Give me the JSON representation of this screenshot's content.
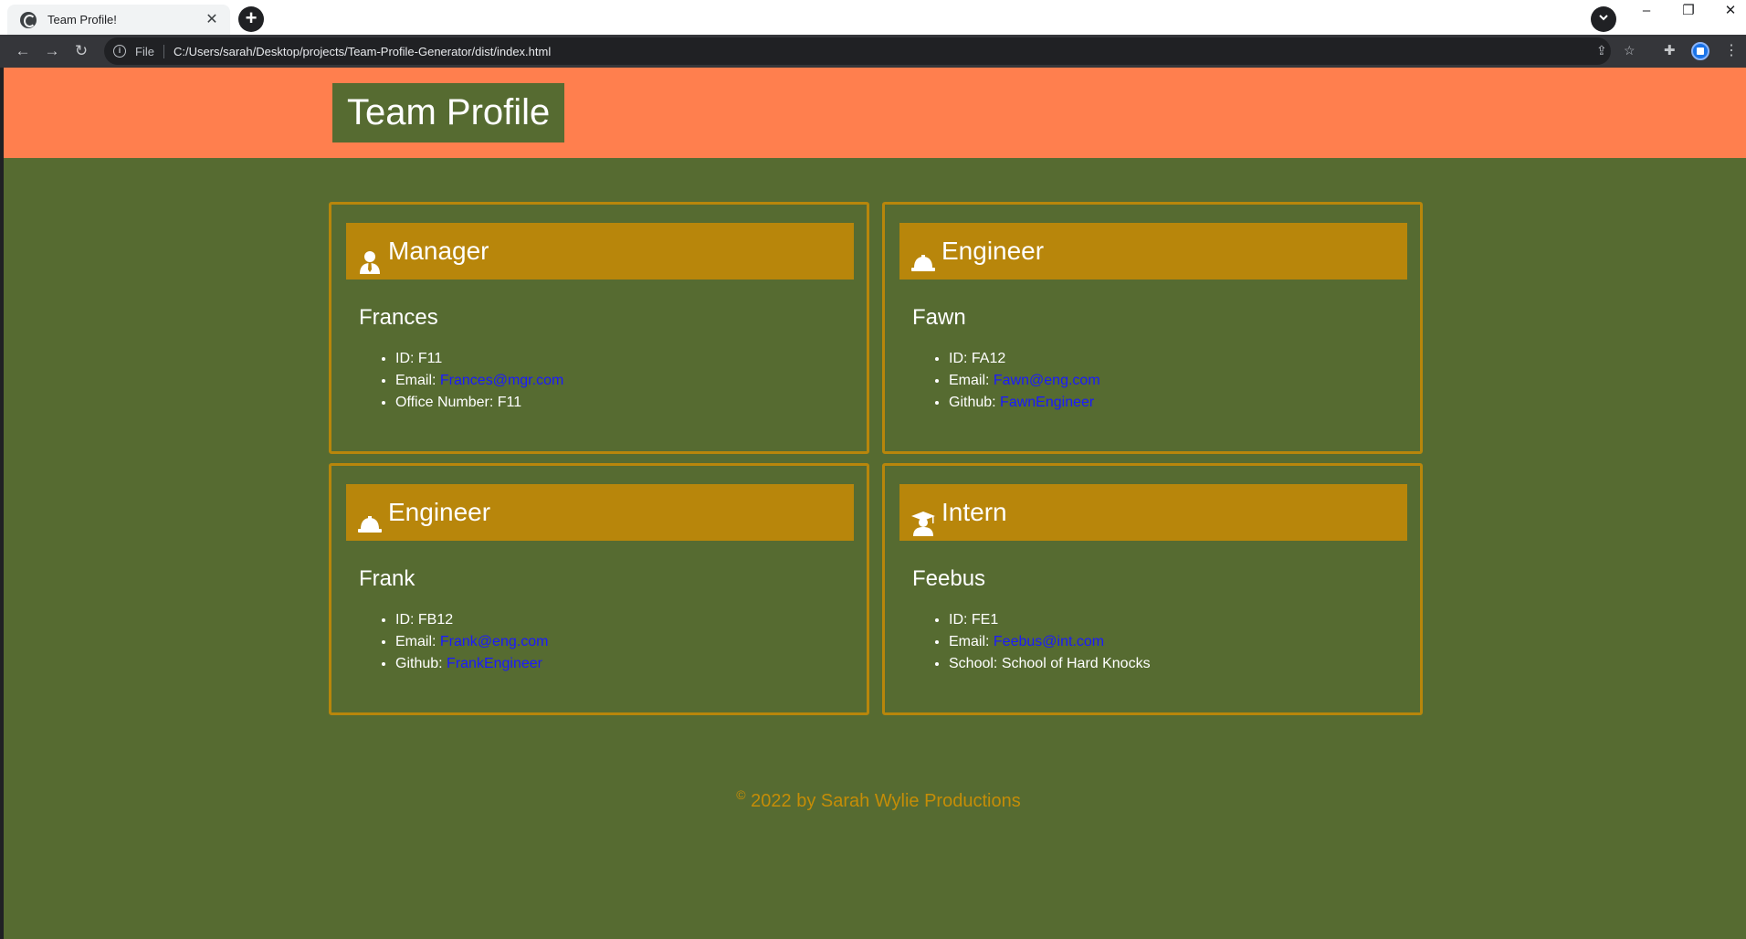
{
  "browser": {
    "tab_title": "Team Profile!",
    "tab_close": "✕",
    "new_tab": "+",
    "scheme": "File",
    "url": "C:/Users/sarah/Desktop/projects/Team-Profile-Generator/dist/index.html",
    "window_controls": {
      "minimize": "–",
      "restore": "❐",
      "close": "✕"
    }
  },
  "header": {
    "title": "Team Profile",
    "background": "#ff7f4e"
  },
  "page_background": "#566b31",
  "accent": "#b8860b",
  "cards": [
    {
      "role": "Manager",
      "icon": "user-tie-icon",
      "name": "Frances",
      "id_label": "ID:",
      "id": "F11",
      "email_label": "Email:",
      "email": "Frances@mgr.com",
      "extra_label": "Office Number:",
      "extra": "F11"
    },
    {
      "role": "Engineer",
      "icon": "hard-hat-icon",
      "name": "Fawn",
      "id_label": "ID:",
      "id": "FA12",
      "email_label": "Email:",
      "email": "Fawn@eng.com",
      "extra_label": "Github:",
      "extra": "FawnEngineer"
    },
    {
      "role": "Engineer",
      "icon": "hard-hat-icon",
      "name": "Frank",
      "id_label": "ID:",
      "id": "FB12",
      "email_label": "Email:",
      "email": "Frank@eng.com",
      "extra_label": "Github:",
      "extra": "FrankEngineer"
    },
    {
      "role": "Intern",
      "icon": "graduate-icon",
      "name": "Feebus",
      "id_label": "ID:",
      "id": "FE1",
      "email_label": "Email:",
      "email": "Feebus@int.com",
      "extra_label": "School:",
      "extra": "School of Hard Knocks"
    }
  ],
  "footer": {
    "copyright_symbol": "©",
    "text": "2022 by Sarah Wylie Productions"
  }
}
